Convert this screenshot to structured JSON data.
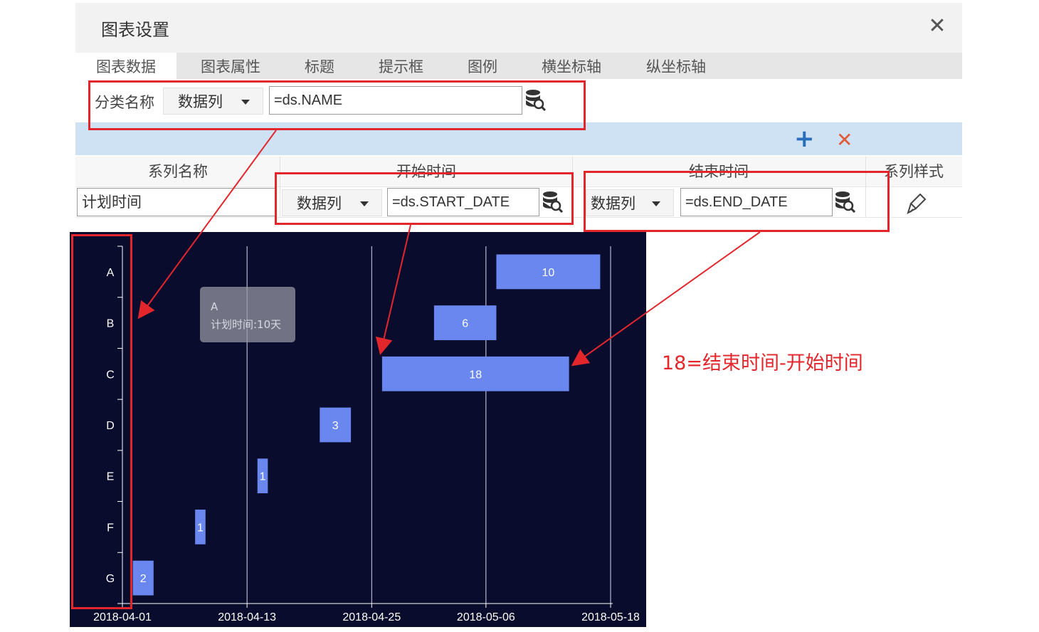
{
  "dialog": {
    "title": "图表设置",
    "close_glyph": "✕"
  },
  "tabs": [
    {
      "label": "图表数据",
      "active": true
    },
    {
      "label": "图表属性"
    },
    {
      "label": "标题"
    },
    {
      "label": "提示框"
    },
    {
      "label": "图例"
    },
    {
      "label": "横坐标轴"
    },
    {
      "label": "纵坐标轴"
    }
  ],
  "category": {
    "label": "分类名称",
    "type_value": "数据列",
    "formula": "=ds.NAME"
  },
  "series_toolbar": {
    "add_glyph": "+",
    "delete_glyph": "✕",
    "add_color": "#2a6ebb",
    "delete_color": "#e05a3a"
  },
  "series_table": {
    "headers": [
      "系列名称",
      "开始时间",
      "结束时间",
      "系列样式"
    ],
    "row": {
      "name": "计划时间",
      "start_type": "数据列",
      "start_formula": "=ds.START_DATE",
      "end_type": "数据列",
      "end_formula": "=ds.END_DATE",
      "style_icon": "brush-icon"
    }
  },
  "annotation": "18=结束时间-开始时间",
  "colors": {
    "highlight": "#e3262b",
    "chart_bg": "#0a0c2e",
    "bar": "#6a87f0"
  },
  "chart_data": {
    "type": "bar",
    "orientation": "horizontal-gantt",
    "categories": [
      "A",
      "B",
      "C",
      "D",
      "E",
      "F",
      "G"
    ],
    "x_ticks": [
      "2018-04-01",
      "2018-04-13",
      "2018-04-25",
      "2018-05-06",
      "2018-05-18"
    ],
    "xlim": [
      "2018-04-01",
      "2018-05-18"
    ],
    "grid": true,
    "series": [
      {
        "bars": [
          {
            "category": "A",
            "start": "2018-05-07",
            "end": "2018-05-17",
            "label": "10"
          },
          {
            "category": "B",
            "start": "2018-05-01",
            "end": "2018-05-07",
            "label": "6"
          },
          {
            "category": "C",
            "start": "2018-04-26",
            "end": "2018-05-14",
            "label": "18"
          },
          {
            "category": "D",
            "start": "2018-04-20",
            "end": "2018-04-23",
            "label": "3"
          },
          {
            "category": "E",
            "start": "2018-04-14",
            "end": "2018-04-15",
            "label": "1"
          },
          {
            "category": "F",
            "start": "2018-04-08",
            "end": "2018-04-09",
            "label": "1"
          },
          {
            "category": "G",
            "start": "2018-04-02",
            "end": "2018-04-04",
            "label": "2"
          }
        ]
      }
    ],
    "tooltip": {
      "title": "A",
      "text": "计划时间:10天"
    }
  }
}
